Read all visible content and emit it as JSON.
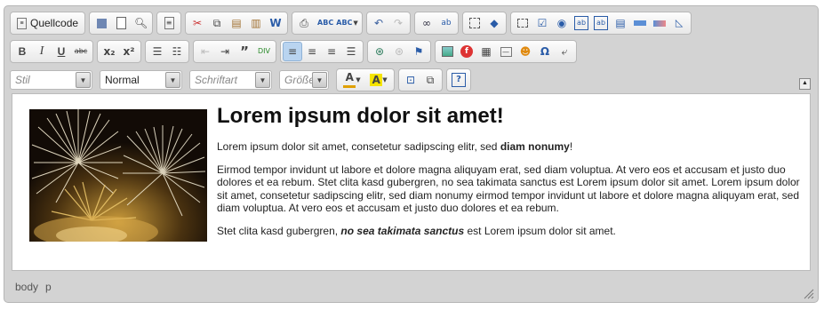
{
  "toolbar": {
    "source_label": "Quellcode",
    "combos": {
      "style": "Stil",
      "format": "Normal",
      "font": "Schriftart",
      "size": "Größe"
    }
  },
  "content": {
    "heading": "Lorem ipsum dolor sit amet!",
    "p1_text": "Lorem ipsum dolor sit amet, consetetur sadipscing elitr, sed ",
    "p1_bold": "diam nonumy",
    "p1_end": "!",
    "p2": "Eirmod tempor invidunt ut labore et dolore magna aliquyam erat, sed diam voluptua. At vero eos et accusam et justo duo dolores et ea rebum. Stet clita kasd gubergren, no sea takimata sanctus est Lorem ipsum dolor sit amet. Lorem ipsum dolor sit amet, consetetur sadipscing elitr, sed diam nonumy eirmod tempor invidunt ut labore et dolore magna aliquyam erat, sed diam voluptua. At vero eos et accusam et justo duo dolores et ea rebum.",
    "p3_text": "Stet clita kasd gubergren, ",
    "p3_bolditalic": "no sea takimata sanctus",
    "p3_end": " est Lorem ipsum dolor sit amet."
  },
  "statusbar": {
    "path": [
      "body",
      "p"
    ]
  },
  "colors": {
    "active_button": "#b9d4f0",
    "frame": "#d3d3d3"
  }
}
